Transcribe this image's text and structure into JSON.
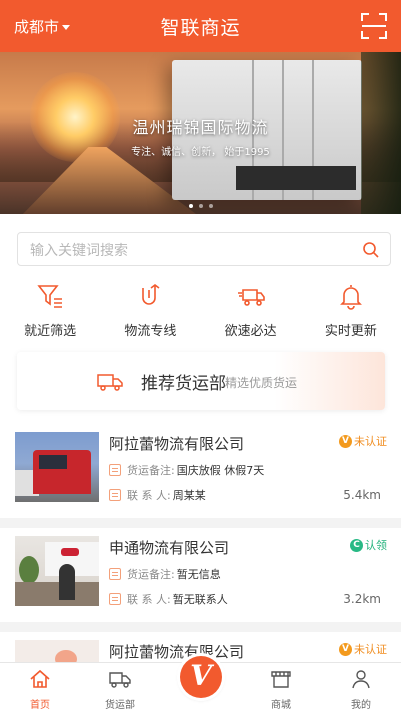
{
  "header": {
    "city": "成都市",
    "title": "智联商运"
  },
  "banner": {
    "title": "温州瑞锦国际物流",
    "subtitle": "专注、诚信、创新，    始于1995",
    "slide_count": 3,
    "active_slide": 1
  },
  "search": {
    "placeholder": "输入关键词搜索"
  },
  "quick_links": [
    {
      "label": "就近筛选",
      "icon": "filter-icon"
    },
    {
      "label": "物流专线",
      "icon": "route-icon"
    },
    {
      "label": "欲速必达",
      "icon": "fast-delivery-icon"
    },
    {
      "label": "实时更新",
      "icon": "bell-icon"
    }
  ],
  "recommend": {
    "title": "推荐货运部",
    "subtitle": "精选优质货运"
  },
  "companies": [
    {
      "name": "阿拉蕾物流有限公司",
      "badge": "未认证",
      "badge_icon": "V",
      "remark_label": "货运备注:",
      "remark": "国庆放假 休假7天",
      "contact_label": "联 系 人:",
      "contact": "周某某",
      "distance": "5.4km"
    },
    {
      "name": "申通物流有限公司",
      "badge": "认领",
      "badge_icon": "C",
      "remark_label": "货运备注:",
      "remark": "暂无信息",
      "contact_label": "联 系 人:",
      "contact": "暂无联系人",
      "distance": "3.2km"
    },
    {
      "name": "阿拉蕾物流有限公司",
      "badge": "未认证",
      "badge_icon": "V"
    }
  ],
  "tabbar": {
    "home": "首页",
    "freight": "货运部",
    "center": "V",
    "mall": "商城",
    "mine": "我的"
  },
  "colors": {
    "accent": "#f25a2e",
    "unverified": "#f08c1e",
    "claimed": "#20b17a"
  }
}
